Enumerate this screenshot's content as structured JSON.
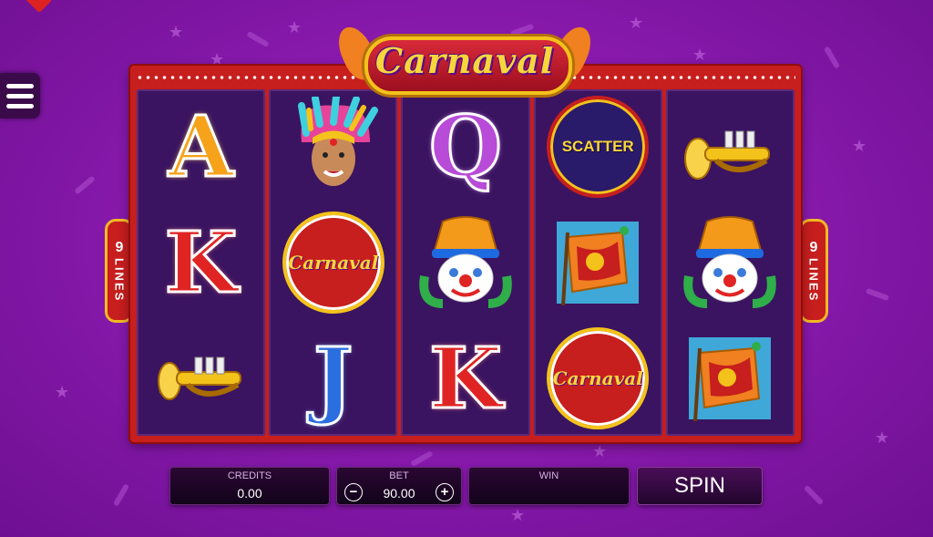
{
  "game": {
    "title": "Carnaval",
    "paylines_label_num": "9",
    "paylines_label_word": "LINES"
  },
  "reels": [
    [
      "A",
      "dancer",
      "K"
    ],
    [
      "K",
      "carnaval-logo",
      "J"
    ],
    [
      "Q",
      "clown",
      "K"
    ],
    [
      "scatter",
      "flag",
      "carnaval-logo"
    ],
    [
      "trumpet",
      "clown",
      "flag"
    ]
  ],
  "reel_col1": [
    "A",
    "K",
    "trumpet"
  ],
  "symbols": {
    "scatter_text": "SCATTER",
    "logo_text": "Carnaval"
  },
  "panel": {
    "credits_label": "CREDITS",
    "credits_value": "0.00",
    "bet_label": "BET",
    "bet_value": "90.00",
    "bet_minus": "−",
    "bet_plus": "+",
    "win_label": "WIN",
    "win_value": "",
    "spin_label": "SPIN"
  },
  "colors": {
    "background": "#8a1aae",
    "frame": "#c71e1e",
    "reel_bg": "#3a1460",
    "gold": "#f3c21b"
  }
}
